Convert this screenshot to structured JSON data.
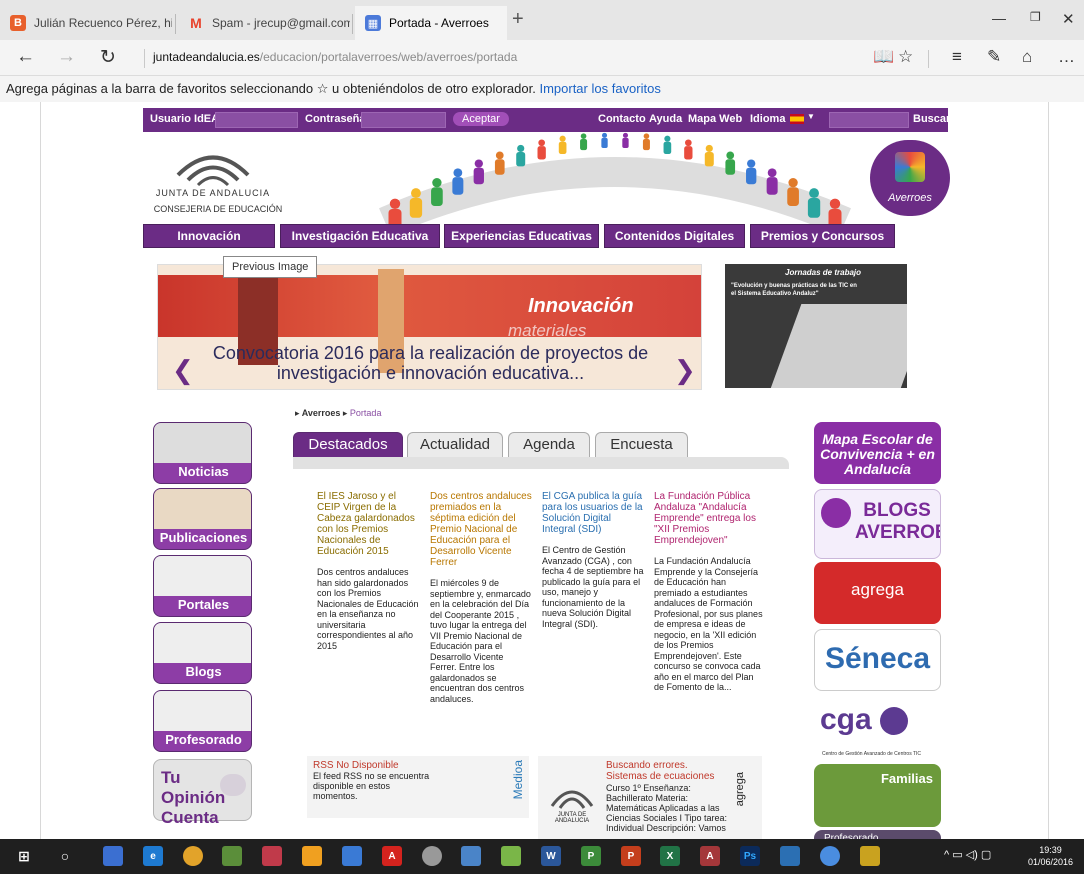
{
  "browser": {
    "tabs": [
      {
        "label": "Julián Recuenco Pérez, histc",
        "color": "#e8602c"
      },
      {
        "label": "Spam - jrecup@gmail.com -",
        "color": "#e8432d"
      },
      {
        "label": "Portada - Averroes",
        "color": "#4c7ad9"
      }
    ],
    "new_tab_label": "+",
    "url_domain": "juntadeandalucia.es",
    "url_rest": "/educacion/portalaverroes/web/averroes/portada",
    "favbar_text": "Agrega páginas a la barra de favoritos seleccionando ☆ u obteniéndolos de otro explorador.",
    "favbar_link": "Importar los favoritos"
  },
  "login": {
    "user_label": "Usuario IdEA",
    "password_label": "Contraseña",
    "accept": "Aceptar",
    "links": [
      "Contacto",
      "Ayuda",
      "Mapa Web",
      "Idioma"
    ],
    "search": "Buscar"
  },
  "header": {
    "junta": "JUNTA DE ANDALUCIA",
    "consejeria": "CONSEJERIA DE EDUCACIÓN",
    "averroes": "Averroes"
  },
  "nav": {
    "items": [
      "Innovación",
      "Investigación Educativa",
      "Experiencias Educativas",
      "Contenidos Digitales",
      "Premios y Concursos"
    ],
    "tooltip": "Previous Image"
  },
  "slider": {
    "innovacion": "Innovación",
    "materiales": "materiales",
    "caption": "Convocatoria 2016 para la realización de proyectos de investigación e innovación educativa...",
    "jornadas_title": "Jornadas de trabajo",
    "jornadas_text": "\"Evolución y buenas prácticas de las TIC en el Sistema Educativo Andaluz\""
  },
  "breadcrumb": {
    "root": "Averroes",
    "current": "Portada"
  },
  "left_buttons": [
    "Noticias",
    "Publicaciones",
    "Portales",
    "Blogs",
    "Profesorado"
  ],
  "opinion": "Tu Opinión Cuenta",
  "content_tabs": [
    "Destacados",
    "Actualidad",
    "Agenda",
    "Encuesta"
  ],
  "news": [
    {
      "title": "El IES Jaroso y el CEIP Virgen de la Cabeza galardonados con los Premios Nacionales de Educación 2015",
      "body": "Dos centros andaluces han sido galardonados con los Premios Nacionales de Educación en la enseñanza no universitaria correspondientes al año 2015",
      "color": "#8a6d00"
    },
    {
      "title": "Dos centros andaluces premiados en la séptima edición del Premio Nacional de Educación para el Desarrollo Vicente Ferrer",
      "body": "El miércoles 9 de septiembre y, enmarcado en la celebración del Día del Cooperante 2015 , tuvo lugar la entrega del VII Premio Nacional de Educación para el Desarrollo Vicente Ferrer. Entre los galardonados se encuentran dos centros andaluces.",
      "color": "#b87700"
    },
    {
      "title": "El CGA publica la guía para los usuarios de la Solución Digital Integral (SDI)",
      "body": "El Centro de Gestión Avanzado (CGA) , con fecha 4 de septiembre ha publicado la guía para el uso, manejo y funcionamiento de la nueva Solución Digital Integral (SDI).",
      "color": "#2a6fb0"
    },
    {
      "title": "La Fundación Pública Andaluza \"Andalucía Emprende\" entrega los \"XII Premios Emprendejoven\"",
      "body": "La Fundación Andalucía Emprende y la Consejería de Educación han premiado a estudiantes andaluces de Formación Profesional, por sus planes de empresa e ideas de negocio, en la 'XII edición de los Premios Emprendejoven'. Este concurso se convoca cada año en el marco del Plan de Fomento de la...",
      "color": "#b0246f"
    }
  ],
  "rss": {
    "title": "RSS No Disponible",
    "body": "El feed RSS no se encuentra disponible en estos momentos.",
    "side": "Medioa"
  },
  "agrega_box": {
    "title": "Buscando errores. Sistemas de ecuaciones",
    "body": "Curso 1º Enseñanza: Bachillerato Materia: Matemáticas Aplicadas a las Ciencias Sociales I Tipo tarea: Individual Descripción: Vamos",
    "side": "agrega",
    "logo": "JUNTA DE ANDALUCIA"
  },
  "right_buttons": {
    "mapa": "Mapa Escolar de Convivencia + en Andalucía",
    "blogs": "BLOGS AVERROES",
    "agrega": "agrega",
    "seneca": "Séneca",
    "cga": "cga",
    "cga_sub": "Centro de Gestión Avanzado de Centros TIC",
    "familias": "Familias",
    "profesorado": "Profesorado"
  },
  "taskbar": {
    "time": "19:39",
    "date": "01/06/2016"
  },
  "colors": {
    "purple": "#6b2c85",
    "accent_blue": "#1a62c5"
  }
}
